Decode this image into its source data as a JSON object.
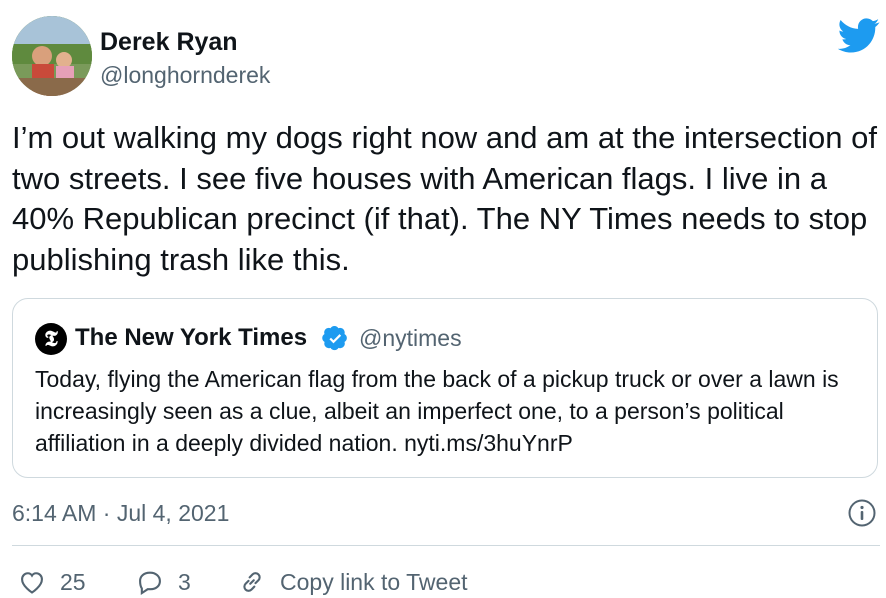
{
  "tweet": {
    "author_name": "Derek Ryan",
    "author_handle": "@longhornderek",
    "text": "I’m out walking my dogs right now and am at the intersection of two streets. I see five houses with American flags. I live in a 40% Republican precinct (if that). The NY Times needs to stop publishing trash like this.",
    "timestamp": "6:14 AM · Jul 4, 2021"
  },
  "quoted_tweet": {
    "logo_glyph": "𝕿",
    "author_name": "The New York Times",
    "author_handle": "@nytimes",
    "text": "Today, flying the American flag from the back of a pickup truck or over a lawn is increasingly seen as a clue, albeit an imperfect one, to a person’s political affiliation in a deeply divided nation. nyti.ms/3huYnrP"
  },
  "actions": {
    "like_count": "25",
    "reply_count": "3",
    "copy_link_label": "Copy link to Tweet"
  },
  "icons": {
    "brand": "twitter-bird-icon",
    "verified": "verified-badge-icon",
    "info": "info-icon",
    "like": "heart-icon",
    "reply": "reply-bubble-icon",
    "copy": "link-icon"
  },
  "colors": {
    "brand_blue": "#1d9bf0",
    "text_primary": "#0f1419",
    "text_secondary": "#536471",
    "border": "#cfd9de"
  }
}
